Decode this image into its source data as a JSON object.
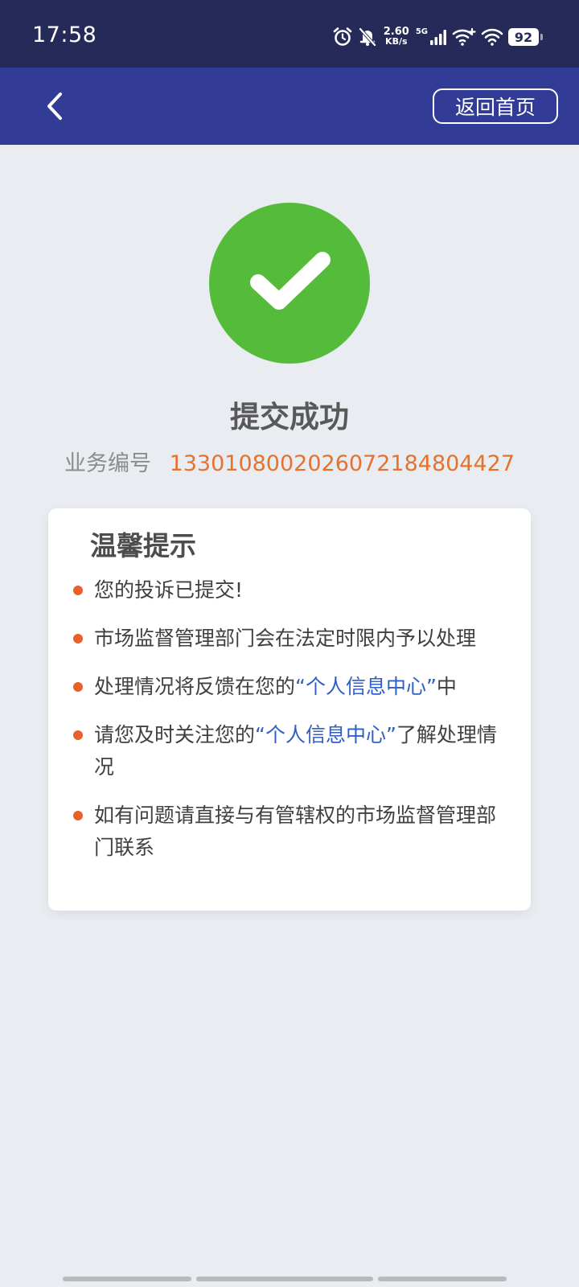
{
  "status_bar": {
    "time": "17:58",
    "net_speed_value": "2.60",
    "net_speed_unit": "KB/s",
    "network": "5G",
    "battery": "92",
    "icons": [
      "alarm-icon",
      "mute-bell-icon",
      "signal-icon",
      "wifi-plus-icon",
      "wifi-icon",
      "battery-icon"
    ]
  },
  "nav": {
    "back_icon": "chevron-left-icon",
    "home_button": "返回首页"
  },
  "result": {
    "icon": "checkmark-icon",
    "title": "提交成功",
    "business_label": "业务编号",
    "business_number": "1330108002026072184804427"
  },
  "tips": {
    "title": "温馨提示",
    "items": [
      {
        "text": "您的投诉已提交!"
      },
      {
        "text": "市场监督管理部门会在法定时限内予以处理"
      },
      {
        "prefix": "处理情况将反馈在您的",
        "highlight": "“个人信息中心”",
        "suffix": "中"
      },
      {
        "prefix": "请您及时关注您的",
        "highlight": "“个人信息中心”",
        "suffix": "了解处理情况"
      },
      {
        "text": "如有问题请直接与有管辖权的市场监督管理部门联系"
      }
    ]
  },
  "colors": {
    "status_bar_bg": "#262a58",
    "nav_bg": "#323c96",
    "success_green": "#55bb3a",
    "number_orange": "#e5732e",
    "bullet_orange": "#e8612c",
    "link_blue": "#2f5fc4",
    "page_bg": "#e9ecf1"
  }
}
